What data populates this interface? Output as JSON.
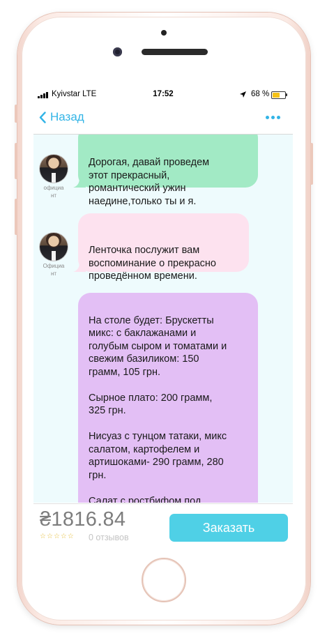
{
  "status_bar": {
    "carrier": "Kyivstar  LTE",
    "time": "17:52",
    "battery_percent": "68 %",
    "battery_level": 0.68,
    "battery_color": "#f5c218"
  },
  "nav": {
    "back_label": "Назад",
    "back_icon": "chevron-left-icon",
    "more_icon": "more-dots-icon",
    "accent_color": "#32b4e6"
  },
  "messages": [
    {
      "author_label": "официа\nнт",
      "text": "Дорогая, давай проведем\nэтот прекрасный,\nромантический ужин\nнаедине,только ты и я.",
      "color": "#a2eac5"
    },
    {
      "author_label": "Официа\nнт",
      "text": "Ленточка послужит вам\nвоспоминание о прекрасно\nпроведённом времени.",
      "color": "#fde2ef"
    },
    {
      "author_label": "",
      "text": "На столе будет: Брускетты\nмикс: с баклажанами и\nголубым сыром и томатами и\nсвежим базиликом: 150\nграмм, 105 грн.\n\nСырное плато: 200 грамм,\n325 грн.\n\nНисуаз с тунцом татаки, микс\nсалатом, картофелем и\nартишоками- 290 грамм, 280\nгрн.\n\nСалат с ростбифом под",
      "color": "#e3bff5"
    }
  ],
  "footer": {
    "price": "₴1816.84",
    "rating_stars": 0,
    "reviews": "0 отзывов",
    "order_button": "Заказать",
    "button_color": "#4fd0e6"
  }
}
